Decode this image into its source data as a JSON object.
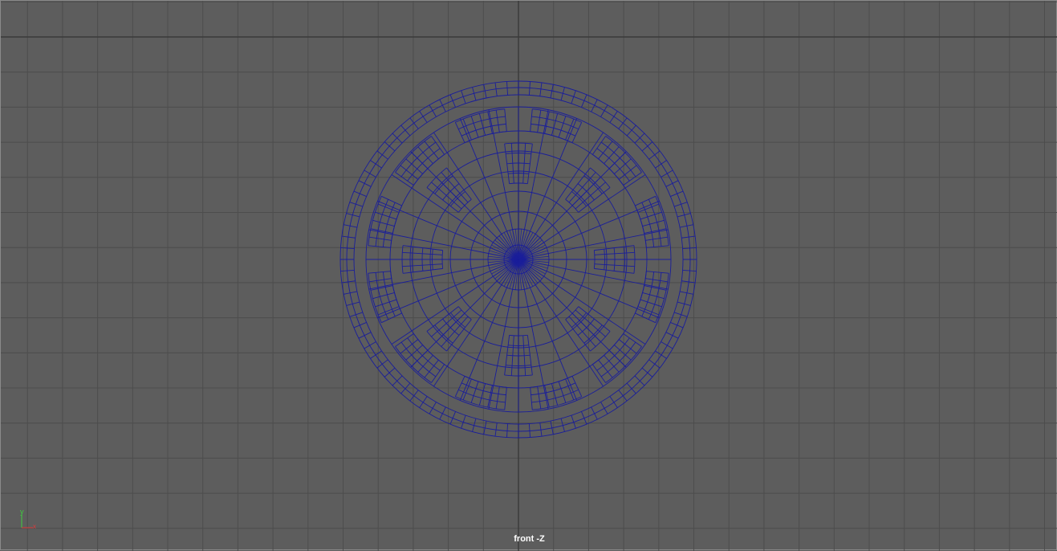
{
  "viewport": {
    "camera_label": "front -Z",
    "background_color": "#5d5d5d",
    "grid_color": "#4d4d4d",
    "axis_line_color": "#3a3a3a",
    "wireframe_color": "#1a1e9a"
  },
  "axis_gizmo": {
    "y_label": "y",
    "x_label": "x",
    "y_color": "#3ecf3e",
    "x_color": "#e03a3a",
    "z_color": "#4a6bd6"
  },
  "model": {
    "type": "wireframe-disc",
    "radial_segments": 32,
    "ring_count": 11
  }
}
